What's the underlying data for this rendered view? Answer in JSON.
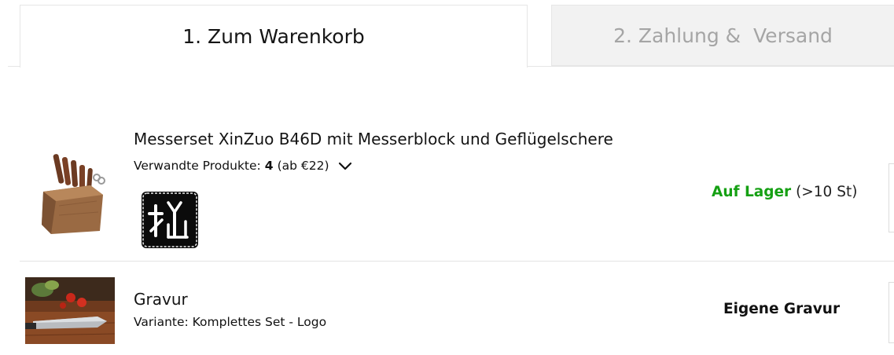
{
  "tabs": [
    {
      "label": "1. Zum Warenkorb",
      "active": true
    },
    {
      "label": "2. Zahlung &  Versand",
      "active": false
    }
  ],
  "cart_items": [
    {
      "title": "Messerset XinZuo B46D mit Messerblock und Geflügelschere",
      "related_label": "Verwandte Produkte:",
      "related_count": "4",
      "related_price": "(ab €22)",
      "stock_status": "Auf Lager",
      "stock_qty": "(>10 St)",
      "image_icon": "knife-block-image",
      "logo_icon": "engraving-logo-badge"
    },
    {
      "title": "Gravur",
      "variant": "Variante: Komplettes Set - Logo",
      "status_label": "Eigene Gravur",
      "image_icon": "engraved-knife-image"
    }
  ],
  "colors": {
    "in_stock": "#15a013",
    "inactive_tab_bg": "#f2f2f2",
    "inactive_tab_text": "#a5a5a5"
  }
}
